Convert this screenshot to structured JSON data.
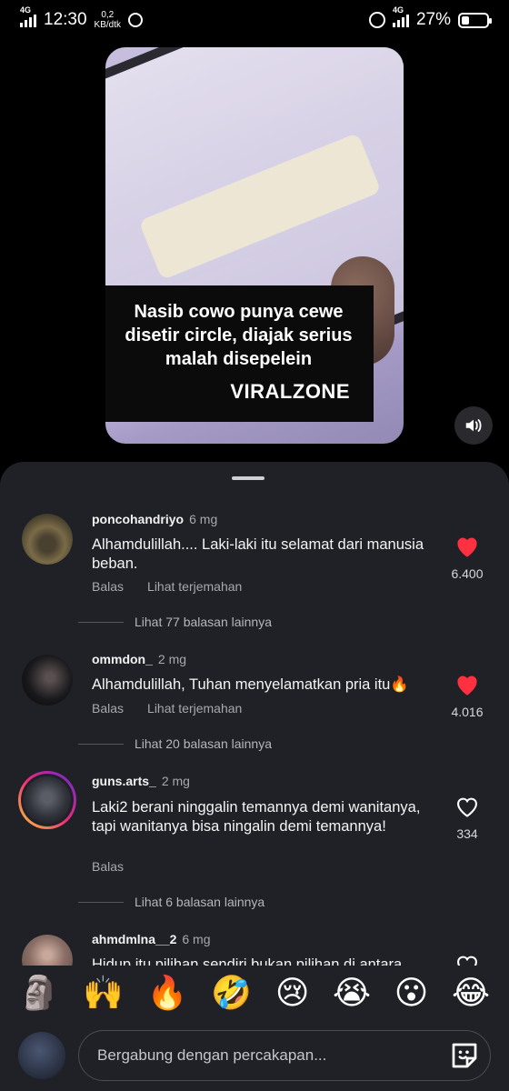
{
  "status": {
    "time": "12:30",
    "net_type_left": "4G",
    "speed_value": "0,2",
    "speed_unit": "KB/dtk",
    "net_type_right": "4G",
    "battery": "27%",
    "battery_level": 0.27
  },
  "video": {
    "caption": "Nasib cowo punya cewe disetir circle, diajak serius malah disepelein",
    "brand": "VIRALZONE"
  },
  "comments": [
    {
      "username": "poncohandriyo",
      "time": "6 mg",
      "text": "Alhamdulillah.... Laki-laki itu selamat dari manusia beban.",
      "reply": "Balas",
      "translate": "Lihat terjemahan",
      "likes": "6.400",
      "liked": true,
      "more_replies": "Lihat 77 balasan lainnya"
    },
    {
      "username": "ommdon_",
      "time": "2 mg",
      "text": "Alhamdulillah, Tuhan menyelamatkan pria itu🔥",
      "reply": "Balas",
      "translate": "Lihat terjemahan",
      "likes": "4.016",
      "liked": true,
      "more_replies": "Lihat 20 balasan lainnya"
    },
    {
      "username": "guns.arts_",
      "time": "2 mg",
      "text": "Laki2 berani ninggalin temannya demi wanitanya, tapi wanitanya bisa ningalin demi temannya!",
      "reply": "Balas",
      "likes": "334",
      "liked": false,
      "more_replies": "Lihat 6 balasan lainnya"
    },
    {
      "username": "ahmdmlna__2",
      "time": "6 mg",
      "text": "Hidup itu pilihan sendiri bukan pilihan di antara"
    }
  ],
  "emoji_bar": [
    "🗿",
    "🙌",
    "🔥",
    "🤣",
    "😢",
    "😭",
    "😮",
    "😂"
  ],
  "input": {
    "placeholder": "Bergabung dengan percakapan..."
  },
  "colors": {
    "like_red": "#ff3040",
    "sheet_bg": "#1f2126"
  }
}
